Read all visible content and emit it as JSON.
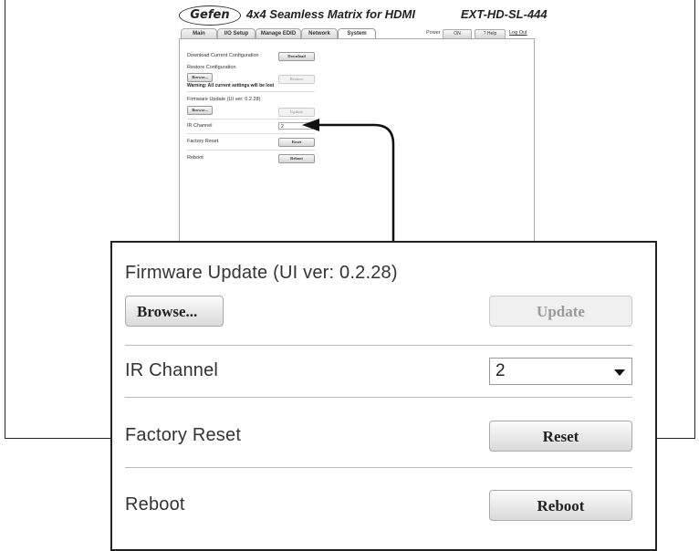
{
  "header": {
    "logo": "Gefen",
    "title": "4x4 Seamless Matrix for HDMI",
    "model": "EXT-HD-SL-444"
  },
  "tabs": [
    {
      "label": "Main"
    },
    {
      "label": "I/O Setup"
    },
    {
      "label": "Manage EDID"
    },
    {
      "label": "Network"
    },
    {
      "label": "System"
    }
  ],
  "topbar": {
    "power_label": "Power",
    "power_button": "ON",
    "help_button": "? Help",
    "logout": "Log Out"
  },
  "system": {
    "download_label": "Download Current Configuration",
    "download_button": "Download",
    "restore_label": "Restore Configuration",
    "restore_browse": "Browse...",
    "restore_button": "Restore",
    "warning": "Warning: All current settings will be lost",
    "firmware_label": "Firmware Update (UI ver: 0.2.28)",
    "firmware_browse": "Browse...",
    "update_button": "Update",
    "ir_label": "IR Channel",
    "ir_value": "2",
    "reset_label": "Factory Reset",
    "reset_button": "Reset",
    "reboot_label": "Reboot",
    "reboot_button": "Reboot"
  },
  "zoom": {
    "firmware_label": "Firmware Update (UI ver: 0.2.28)",
    "browse_button": "Browse...",
    "update_button": "Update",
    "ir_label": "IR Channel",
    "ir_value": "2",
    "reset_label": "Factory Reset",
    "reset_button": "Reset",
    "reboot_label": "Reboot",
    "reboot_button": "Reboot"
  }
}
